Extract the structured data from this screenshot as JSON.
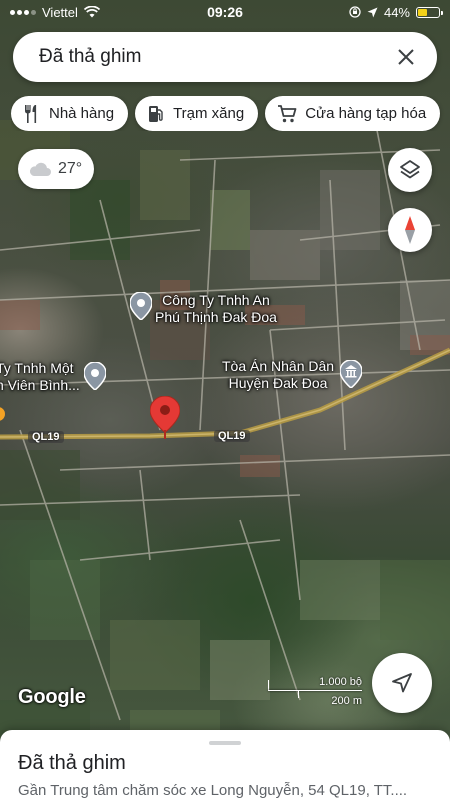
{
  "status_bar": {
    "carrier": "Viettel",
    "time": "09:26",
    "battery": "44%",
    "battery_level": 0.44
  },
  "search": {
    "query": "Đã thả ghim"
  },
  "chips": [
    {
      "label": "Nhà hàng",
      "icon": "fork-knife-icon"
    },
    {
      "label": "Trạm xăng",
      "icon": "gas-station-icon"
    },
    {
      "label": "Cửa hàng tạp hóa",
      "icon": "cart-icon"
    }
  ],
  "weather": {
    "temperature": "27°",
    "icon": "cloud-icon"
  },
  "map_labels": {
    "poi1_line1": "Công Ty Tnhh An",
    "poi1_line2": "Phú Thịnh Đak Đoa",
    "poi2_line1": "Ty Tnhh Một",
    "poi2_line2": "n Viên Bình...",
    "poi3_line1": "Tòa Án Nhân Dân",
    "poi3_line2": "Huyện Đak Đoa",
    "road_shield_1": "QL19",
    "road_shield_2": "QL19"
  },
  "attribution": "Google",
  "scale": {
    "imperial": "1.000 bộ",
    "metric": "200 m"
  },
  "bottom_sheet": {
    "title": "Đã thả ghim",
    "address": "Gần Trung tâm chăm sóc xe Long Nguyễn, 54 QL19, TT...."
  },
  "colors": {
    "pin": "#e53935",
    "poi_pin": "#8a96a3",
    "highway": "#b59a45",
    "compass_red": "#ea4335"
  }
}
